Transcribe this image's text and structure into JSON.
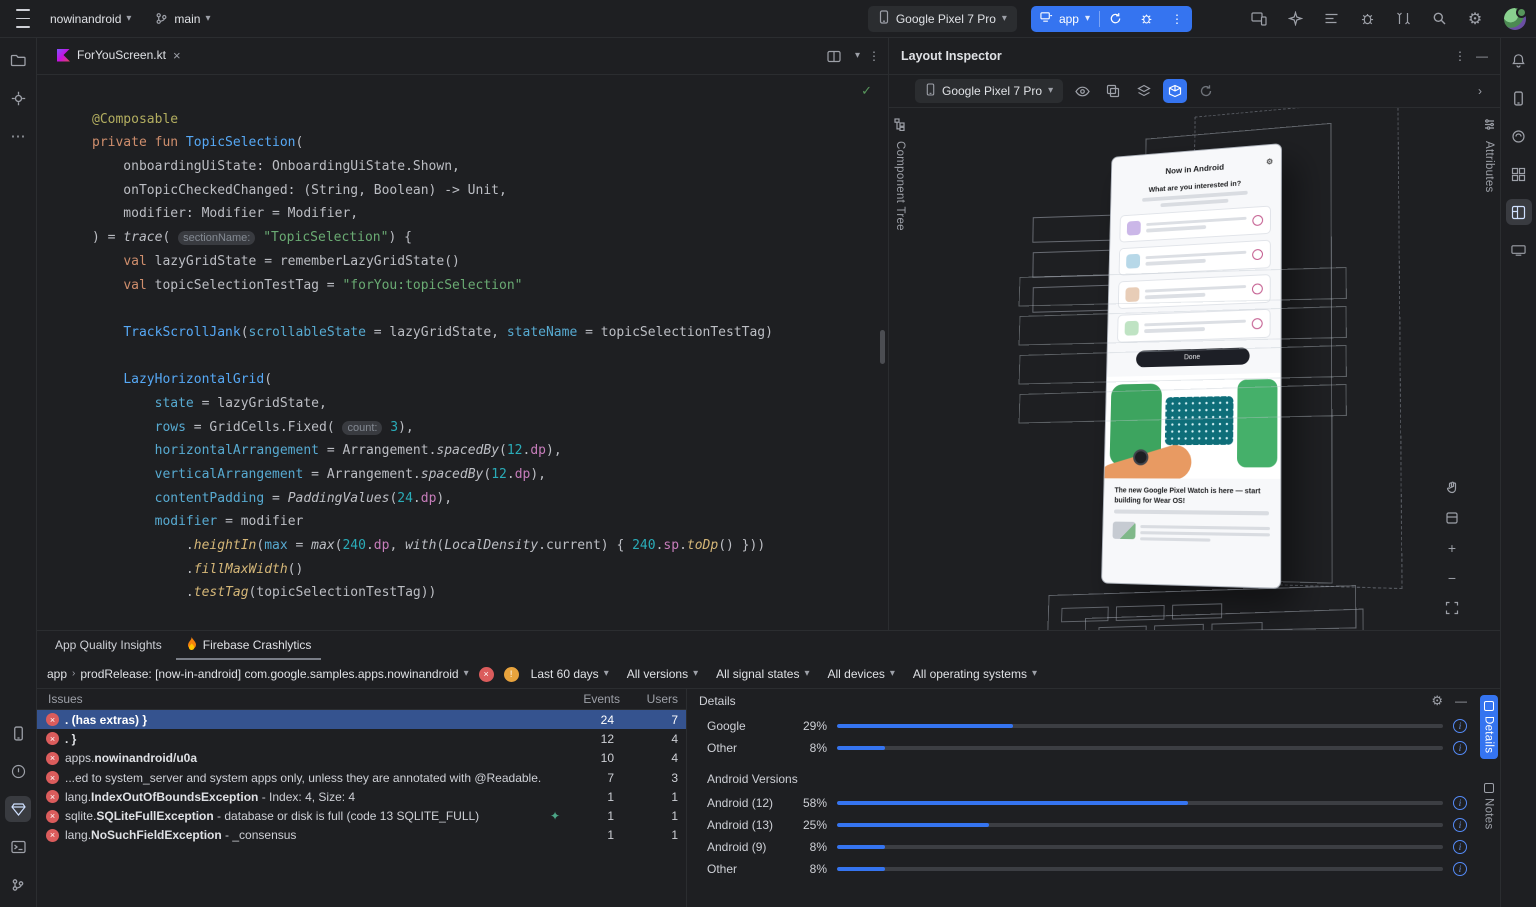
{
  "icons": {
    "chevron_down": "▾",
    "chevron_right": "›",
    "close": "×",
    "kebab": "⋮",
    "minimize": "—",
    "gear": "⚙",
    "check": "✓",
    "plus": "+",
    "minus": "−",
    "error_x": "×",
    "warning_mark": "!",
    "info": "i",
    "sparkle": "✦"
  },
  "topbar": {
    "project": "nowinandroid",
    "branch": "main",
    "device": "Google Pixel 7 Pro",
    "run_config": "app"
  },
  "editor": {
    "tab_title": "ForYouScreen.kt",
    "code_lines": [
      [],
      [
        [
          "a",
          "@Composable"
        ]
      ],
      [
        [
          "k",
          "private fun "
        ],
        [
          "f",
          "TopicSelection"
        ],
        [
          "p",
          "("
        ]
      ],
      [
        [
          "p",
          "    onboardingUiState: OnboardingUiState.Shown,"
        ]
      ],
      [
        [
          "p",
          "    onTopicCheckedChanged: (String, Boolean) -> Unit,"
        ]
      ],
      [
        [
          "p",
          "    modifier: Modifier = Modifier,"
        ]
      ],
      [
        [
          "p",
          ") = "
        ],
        [
          "i",
          "trace"
        ],
        [
          "p",
          "( "
        ],
        [
          "h",
          "sectionName:"
        ],
        [
          "p",
          " "
        ],
        [
          "s",
          "\"TopicSelection\""
        ],
        [
          "p",
          ") {"
        ]
      ],
      [
        [
          "p",
          "    "
        ],
        [
          "k",
          "val "
        ],
        [
          "p",
          "lazyGridState = rememberLazyGridState()"
        ]
      ],
      [
        [
          "p",
          "    "
        ],
        [
          "k",
          "val "
        ],
        [
          "p",
          "topicSelectionTestTag = "
        ],
        [
          "s",
          "\"forYou:topicSelection\""
        ]
      ],
      [],
      [
        [
          "p",
          "    "
        ],
        [
          "f",
          "TrackScrollJank"
        ],
        [
          "p",
          "("
        ],
        [
          "n",
          "scrollableState"
        ],
        [
          "p",
          " = lazyGridState, "
        ],
        [
          "n",
          "stateName"
        ],
        [
          "p",
          " = topicSelectionTestTag)"
        ]
      ],
      [],
      [
        [
          "p",
          "    "
        ],
        [
          "f",
          "LazyHorizontalGrid"
        ],
        [
          "p",
          "("
        ]
      ],
      [
        [
          "p",
          "        "
        ],
        [
          "n",
          "state"
        ],
        [
          "p",
          " = lazyGridState,"
        ]
      ],
      [
        [
          "p",
          "        "
        ],
        [
          "n",
          "rows"
        ],
        [
          "p",
          " = GridCells.Fixed( "
        ],
        [
          "h",
          "count:"
        ],
        [
          "p",
          " "
        ],
        [
          "m",
          "3"
        ],
        [
          "p",
          "),"
        ]
      ],
      [
        [
          "p",
          "        "
        ],
        [
          "n",
          "horizontalArrangement"
        ],
        [
          "p",
          " = Arrangement."
        ],
        [
          "i",
          "spacedBy"
        ],
        [
          "p",
          "("
        ],
        [
          "m",
          "12"
        ],
        [
          "p",
          "."
        ],
        [
          "e",
          "dp"
        ],
        [
          "p",
          "),"
        ]
      ],
      [
        [
          "p",
          "        "
        ],
        [
          "n",
          "verticalArrangement"
        ],
        [
          "p",
          " = Arrangement."
        ],
        [
          "i",
          "spacedBy"
        ],
        [
          "p",
          "("
        ],
        [
          "m",
          "12"
        ],
        [
          "p",
          "."
        ],
        [
          "e",
          "dp"
        ],
        [
          "p",
          "),"
        ]
      ],
      [
        [
          "p",
          "        "
        ],
        [
          "n",
          "contentPadding"
        ],
        [
          "p",
          " = "
        ],
        [
          "i",
          "PaddingValues"
        ],
        [
          "p",
          "("
        ],
        [
          "m",
          "24"
        ],
        [
          "p",
          "."
        ],
        [
          "e",
          "dp"
        ],
        [
          "p",
          "),"
        ]
      ],
      [
        [
          "p",
          "        "
        ],
        [
          "n",
          "modifier"
        ],
        [
          "p",
          " = modifier"
        ]
      ],
      [
        [
          "p",
          "            ."
        ],
        [
          "g",
          "heightIn"
        ],
        [
          "p",
          "("
        ],
        [
          "n",
          "max"
        ],
        [
          "p",
          " = "
        ],
        [
          "i",
          "max"
        ],
        [
          "p",
          "("
        ],
        [
          "m",
          "240"
        ],
        [
          "p",
          "."
        ],
        [
          "e",
          "dp"
        ],
        [
          "p",
          ", "
        ],
        [
          "i",
          "with"
        ],
        [
          "p",
          "("
        ],
        [
          "i",
          "LocalDensity"
        ],
        [
          "p",
          ".current) { "
        ],
        [
          "m",
          "240"
        ],
        [
          "p",
          "."
        ],
        [
          "e",
          "sp"
        ],
        [
          "p",
          "."
        ],
        [
          "g",
          "toDp"
        ],
        [
          "p",
          "() }))"
        ]
      ],
      [
        [
          "p",
          "            ."
        ],
        [
          "g",
          "fillMaxWidth"
        ],
        [
          "p",
          "()"
        ]
      ],
      [
        [
          "p",
          "            ."
        ],
        [
          "g",
          "testTag"
        ],
        [
          "p",
          "(topicSelectionTestTag))"
        ]
      ]
    ]
  },
  "inspector": {
    "title": "Layout Inspector",
    "device": "Google Pixel 7 Pro",
    "component_tree_tab": "Component Tree",
    "attributes_tab": "Attributes",
    "phone": {
      "app_title": "Now in Android",
      "onboarding_title": "What are you interested in?",
      "done_button": "Done",
      "card_title": "The new Google Pixel Watch is here — start building for Wear OS!"
    }
  },
  "bottom": {
    "tabs": [
      {
        "label": "App Quality Insights"
      },
      {
        "label": "Firebase Crashlytics"
      }
    ],
    "filter": {
      "scope_app": "app",
      "scope_rest": "prodRelease: [now-in-android] com.google.samples.apps.nowinandroid",
      "dropdowns": [
        "Last 60 days",
        "All versions",
        "All signal states",
        "All devices",
        "All operating systems"
      ]
    },
    "issues": {
      "columns": {
        "issues": "Issues",
        "events": "Events",
        "users": "Users"
      },
      "rows": [
        {
          "selected": true,
          "parts": [
            {
              "b": true,
              "t": ". (has extras) }"
            }
          ],
          "events": "24",
          "users": "7"
        },
        {
          "parts": [
            {
              "b": true,
              "t": ". }"
            }
          ],
          "events": "12",
          "users": "4"
        },
        {
          "parts": [
            {
              "b": false,
              "t": "apps."
            },
            {
              "b": true,
              "t": "nowinandroid/u0a"
            }
          ],
          "events": "10",
          "users": "4"
        },
        {
          "parts": [
            {
              "b": false,
              "t": "...ed to system_server and system apps only, unless they are annotated with @Readable."
            }
          ],
          "events": "7",
          "users": "3"
        },
        {
          "parts": [
            {
              "b": false,
              "t": "lang."
            },
            {
              "b": true,
              "t": "IndexOutOfBoundsException"
            },
            {
              "b": false,
              "t": " - Index: 4, Size: 4"
            }
          ],
          "events": "1",
          "users": "1"
        },
        {
          "parts": [
            {
              "b": false,
              "t": "sqlite."
            },
            {
              "b": true,
              "t": "SQLiteFullException"
            },
            {
              "b": false,
              "t": " - database or disk is full (code 13 SQLITE_FULL)"
            }
          ],
          "sparkle": true,
          "events": "1",
          "users": "1"
        },
        {
          "parts": [
            {
              "b": false,
              "t": "lang."
            },
            {
              "b": true,
              "t": "NoSuchFieldException"
            },
            {
              "b": false,
              "t": " - _consensus"
            }
          ],
          "events": "1",
          "users": "1"
        }
      ]
    },
    "details": {
      "title": "Details",
      "overall": [
        {
          "label": "Google",
          "pct": "29%",
          "value": 29
        },
        {
          "label": "Other",
          "pct": "8%",
          "value": 8
        }
      ],
      "versions_title": "Android Versions",
      "versions": [
        {
          "label": "Android (12)",
          "pct": "58%",
          "value": 58
        },
        {
          "label": "Android (13)",
          "pct": "25%",
          "value": 25
        },
        {
          "label": "Android (9)",
          "pct": "8%",
          "value": 8
        },
        {
          "label": "Other",
          "pct": "8%",
          "value": 8
        }
      ],
      "side_tabs": [
        "Details",
        "Notes"
      ]
    }
  },
  "colors": {
    "accent": "#3574F0",
    "error": "#DB5C5C",
    "warning": "#E8A33D",
    "success": "#57965C"
  }
}
